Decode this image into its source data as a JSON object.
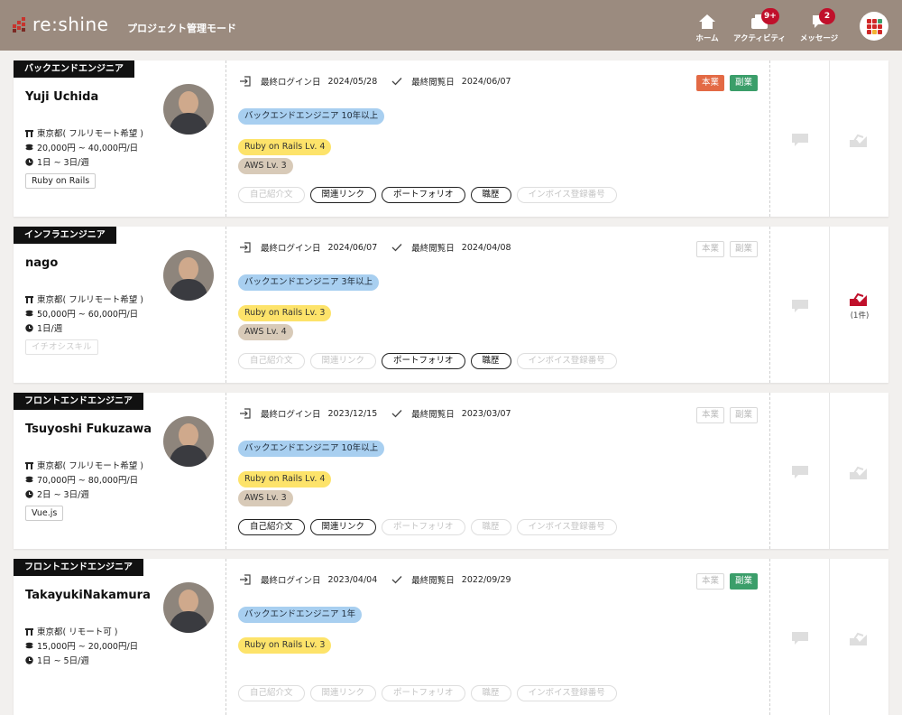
{
  "header": {
    "logo_text": "re:shine",
    "mode": "プロジェクト管理モード",
    "nav": [
      {
        "label": "ホーム",
        "icon": "home-icon"
      },
      {
        "label": "アクティビティ",
        "icon": "activity-icon",
        "badge": "9+"
      },
      {
        "label": "メッセージ",
        "icon": "message-icon",
        "badge": "2"
      }
    ],
    "menu_icon": "app-grid-icon"
  },
  "labels": {
    "last_login": "最終ログイン日",
    "last_viewed": "最終閲覧日",
    "main_job": "本業",
    "side_job": "副業",
    "links": [
      "自己紹介文",
      "関連リンク",
      "ポートフォリオ",
      "職歴",
      "インボイス登録番号"
    ]
  },
  "colors": {
    "header_bg": "#9b8b7f",
    "main_job_on": "#e36a45",
    "side_job_on": "#3b9e6a",
    "scout_active": "#c0102b"
  },
  "candidates": [
    {
      "role": "バックエンドエンジニア",
      "name": "Yuji Uchida",
      "location": "東京都( フルリモート希望 )",
      "rate": "20,000円 ~ 40,000円/日",
      "days": "1日 ~ 3日/週",
      "top_skill": "Ruby on Rails",
      "top_skill_empty": false,
      "last_login": "2024/05/28",
      "last_viewed": "2024/06/07",
      "main_job": true,
      "side_job": true,
      "experience": "バックエンドエンジニア 10年以上",
      "skills": [
        "Ruby on Rails Lv. 4",
        "AWS Lv. 3"
      ],
      "links_active": [
        false,
        true,
        true,
        true,
        false
      ],
      "scout": ""
    },
    {
      "role": "インフラエンジニア",
      "name": "nago",
      "location": "東京都( フルリモート希望 )",
      "rate": "50,000円 ~ 60,000円/日",
      "days": "1日/週",
      "top_skill": "イチオシスキル",
      "top_skill_empty": true,
      "last_login": "2024/06/07",
      "last_viewed": "2024/04/08",
      "main_job": false,
      "side_job": false,
      "experience": "バックエンドエンジニア 3年以上",
      "skills": [
        "Ruby on Rails Lv. 3",
        "AWS Lv. 4"
      ],
      "links_active": [
        false,
        false,
        true,
        true,
        false
      ],
      "scout": "(1件)"
    },
    {
      "role": "フロントエンドエンジニア",
      "name": "Tsuyoshi Fukuzawa",
      "location": "東京都( フルリモート希望 )",
      "rate": "70,000円 ~ 80,000円/日",
      "days": "2日 ~ 3日/週",
      "top_skill": "Vue.js",
      "top_skill_empty": false,
      "last_login": "2023/12/15",
      "last_viewed": "2023/03/07",
      "main_job": false,
      "side_job": false,
      "experience": "バックエンドエンジニア 10年以上",
      "skills": [
        "Ruby on Rails Lv. 4",
        "AWS Lv. 3"
      ],
      "links_active": [
        true,
        true,
        false,
        false,
        false
      ],
      "scout": ""
    },
    {
      "role": "フロントエンドエンジニア",
      "name": "TakayukiNakamura",
      "location": "東京都( リモート可 )",
      "rate": "15,000円 ~ 20,000円/日",
      "days": "1日 ~ 5日/週",
      "top_skill": "",
      "top_skill_empty": false,
      "last_login": "2023/04/04",
      "last_viewed": "2022/09/29",
      "main_job": false,
      "side_job": true,
      "experience": "バックエンドエンジニア 1年",
      "skills": [
        "Ruby on Rails Lv. 3",
        ""
      ],
      "links_active": [
        false,
        false,
        false,
        false,
        false
      ],
      "scout": ""
    }
  ]
}
